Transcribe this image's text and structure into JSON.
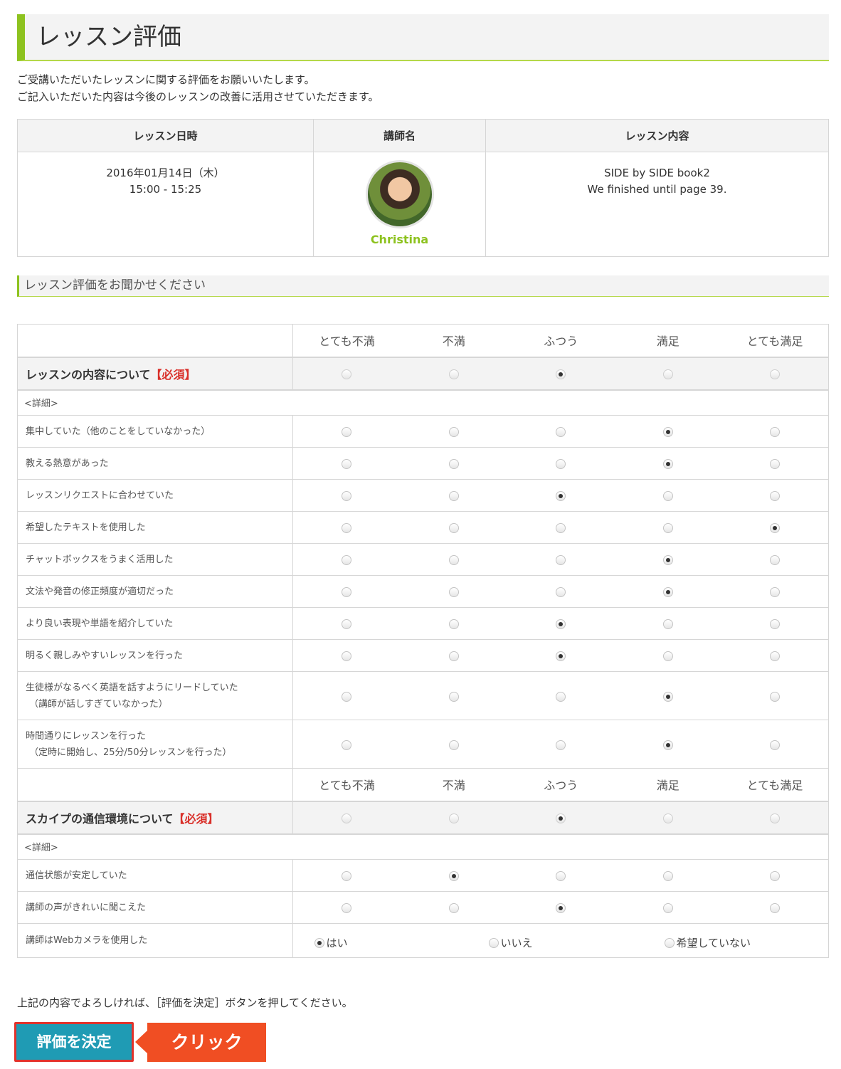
{
  "page_title": "レッスン評価",
  "intro": [
    "ご受講いただいたレッスンに関する評価をお願いいたします。",
    "ご記入いただいた内容は今後のレッスンの改善に活用させていただきます。"
  ],
  "info_table": {
    "headers": [
      "レッスン日時",
      "講師名",
      "レッスン内容"
    ],
    "date_line1": "2016年01月14日（木）",
    "date_line2": "15:00 - 15:25",
    "teacher_name": "Christina",
    "content_line1": "SIDE by SIDE book2",
    "content_line2": "We finished until page 39."
  },
  "section_title": "レッスン評価をお聞かせください",
  "scale_labels": [
    "とても不満",
    "不満",
    "ふつう",
    "満足",
    "とても満足"
  ],
  "lesson_content": {
    "label": "レッスンの内容について",
    "required": "【必須】",
    "selected": 3,
    "detail_label": "<詳細>",
    "questions": [
      {
        "label": "集中していた（他のことをしていなかった）",
        "sub": "",
        "selected": 4
      },
      {
        "label": "教える熱意があった",
        "sub": "",
        "selected": 4
      },
      {
        "label": "レッスンリクエストに合わせていた",
        "sub": "",
        "selected": 3
      },
      {
        "label": "希望したテキストを使用した",
        "sub": "",
        "selected": 5
      },
      {
        "label": "チャットボックスをうまく活用した",
        "sub": "",
        "selected": 4
      },
      {
        "label": "文法や発音の修正頻度が適切だった",
        "sub": "",
        "selected": 4
      },
      {
        "label": "より良い表現や単語を紹介していた",
        "sub": "",
        "selected": 3
      },
      {
        "label": "明るく親しみやすいレッスンを行った",
        "sub": "",
        "selected": 3
      },
      {
        "label": "生徒様がなるべく英語を話すようにリードしていた",
        "sub": "（講師が話しすぎていなかった）",
        "selected": 4
      },
      {
        "label": "時間通りにレッスンを行った",
        "sub": "（定時に開始し、25分/50分レッスンを行った）",
        "selected": 4
      }
    ]
  },
  "skype": {
    "label": "スカイプの通信環境について",
    "required": "【必須】",
    "selected": 3,
    "detail_label": "<詳細>",
    "questions": [
      {
        "label": "通信状態が安定していた",
        "selected": 2
      },
      {
        "label": "講師の声がきれいに聞こえた",
        "selected": 3
      }
    ],
    "webcam": {
      "label": "講師はWebカメラを使用した",
      "options": [
        "はい",
        "いいえ",
        "希望していない"
      ],
      "selected": 1
    }
  },
  "footer_text": "上記の内容でよろしければ、［評価を決定］ボタンを押してください。",
  "submit_label": "評価を決定",
  "callout_label": "クリック",
  "colors": {
    "accent_green": "#8dc21f",
    "button_teal": "#1f9bb4",
    "callout_orange": "#f04e23",
    "required_red": "#d9302a"
  }
}
